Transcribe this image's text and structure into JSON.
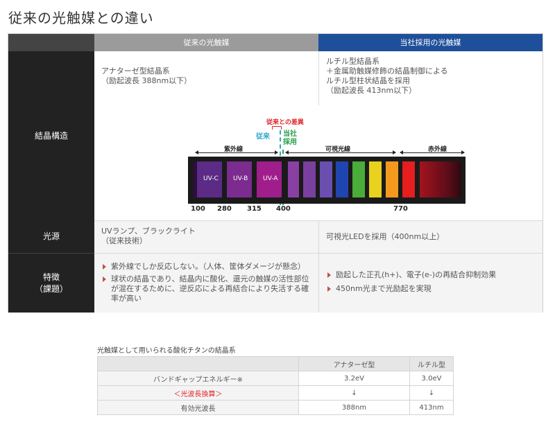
{
  "title": "従来の光触媒との違い",
  "header": {
    "col1": "従来の光触媒",
    "col2": "当社採用の光触媒"
  },
  "colors": {
    "col1_header": "#9b9b9b",
    "col2_header": "#1e4f9a",
    "label_bg": "#222222",
    "bullet": "#c0504d",
    "accent_red": "#e0242a",
    "accent_cyan": "#2ea7c9",
    "accent_green": "#27a048"
  },
  "rows": {
    "crystal": {
      "label": "結晶構造",
      "col1": [
        "アナターゼ型結晶系",
        "（励起波長 388nm以下）"
      ],
      "col2": [
        "ルチル型結晶系",
        "＋金属助触媒修飾の結晶制御による",
        "ルチル型柱状結晶を採用",
        "（励起波長 413nm以下）"
      ]
    },
    "light": {
      "label": "光源",
      "col1": [
        "UVランプ、ブラックライト",
        "（従来技術）"
      ],
      "col2": [
        "可視光LEDを採用（400nm以上）"
      ]
    },
    "feature": {
      "label": [
        "特徴",
        "（課題）"
      ],
      "col1": [
        "紫外線でしか反応しない。（人体、筐体ダメージが懸念）",
        "球状の結晶であり、結晶内に酸化、還元の触媒の活性部位が混在するために、逆反応による再結合により失活する確率が高い"
      ],
      "col2": [
        "励起した正孔(h+)、電子(e-)の再結合抑制効果",
        "450nm光まで光励起を実現"
      ]
    }
  },
  "spectrum": {
    "diff_label": "従来との差異",
    "conventional": "従来",
    "ours": [
      "当社",
      "採用"
    ],
    "region_uv": "紫外線",
    "region_visible": "可視光線",
    "region_ir": "赤外線",
    "uv_bands": [
      "UV-C",
      "UV-B",
      "UV-A"
    ],
    "ticks": [
      "100",
      "280",
      "315",
      "400",
      "770"
    ],
    "visible_colors": [
      "#7b3fa0",
      "#6a4fb0",
      "#1f45b0",
      "#4aad3a",
      "#e8d21e",
      "#f39a1e",
      "#e61e1e"
    ]
  },
  "table2": {
    "title": "光触媒として用いられる酸化チタンの結晶系",
    "headers": [
      "",
      "アナターゼ型",
      "ルチル型"
    ],
    "rows": [
      [
        "バンドギャップエネルギー※",
        "3.2eV",
        "3.0eV"
      ],
      [
        "＜光波長換算＞",
        "↓",
        "↓"
      ],
      [
        "有効光波長",
        "388nm",
        "413nm"
      ]
    ]
  }
}
